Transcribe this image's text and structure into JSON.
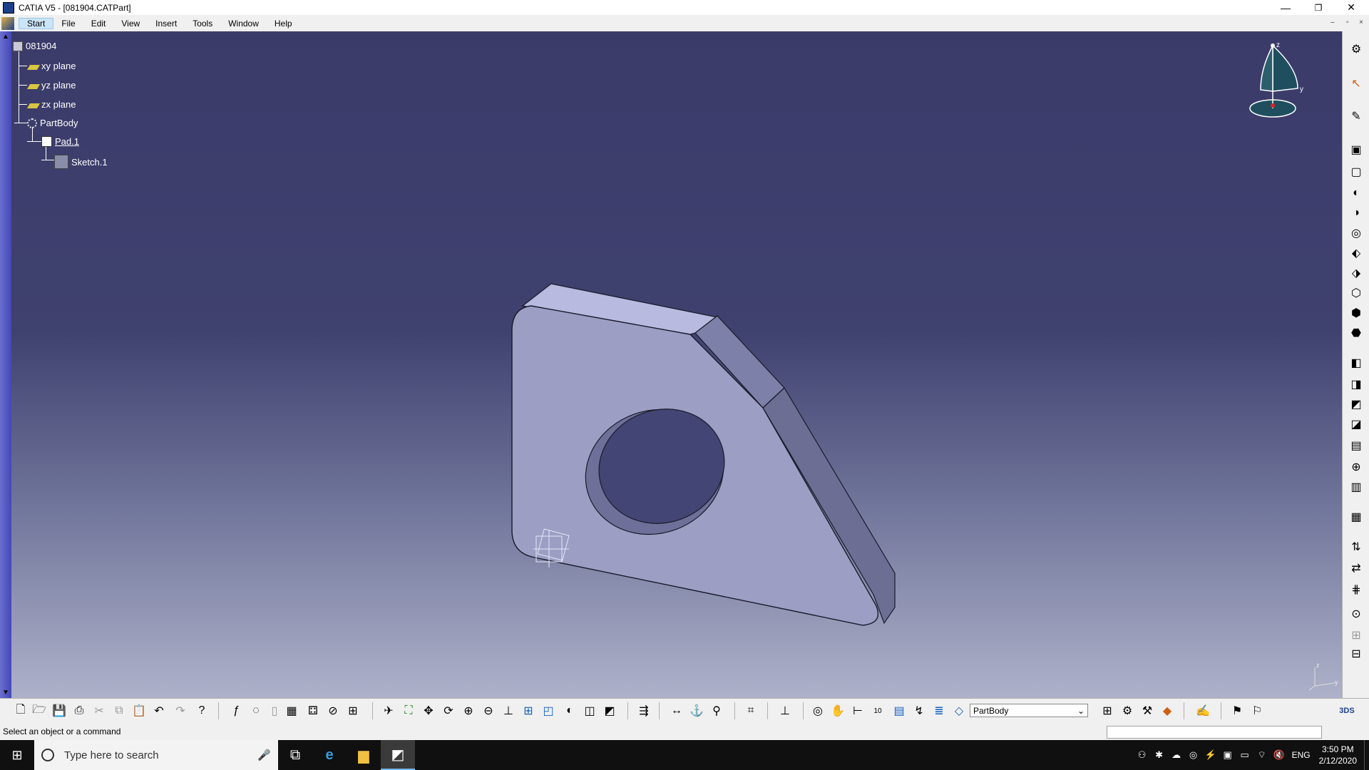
{
  "window": {
    "title": "CATIA V5 - [081904.CATPart]",
    "controls": {
      "minimize": "—",
      "restore": "❐",
      "close": "✕"
    }
  },
  "menubar": {
    "items": [
      "Start",
      "File",
      "Edit",
      "View",
      "Insert",
      "Tools",
      "Window",
      "Help"
    ],
    "active_index": 0
  },
  "mdi_controls": {
    "minimize": "–",
    "restore": "▫",
    "close": "×"
  },
  "spec_tree": {
    "root": "081904",
    "nodes": [
      {
        "label": "xy plane",
        "icon": "plane-icon"
      },
      {
        "label": "yz plane",
        "icon": "plane-icon"
      },
      {
        "label": "zx plane",
        "icon": "plane-icon"
      },
      {
        "label": "PartBody",
        "icon": "body-icon"
      },
      {
        "label": "Pad.1",
        "icon": "pad-icon"
      },
      {
        "label": "Sketch.1",
        "icon": "sketch-icon"
      }
    ]
  },
  "compass": {
    "x": "x",
    "y": "y",
    "z": "z"
  },
  "axis_triad": {
    "z": "z",
    "y": "y",
    "x": "x"
  },
  "toolbar_bottom": {
    "active_body": "PartBody"
  },
  "status": {
    "message": "Select an object or a command"
  },
  "taskbar": {
    "search_placeholder": "Type here to search",
    "language": "ENG",
    "time": "3:50 PM",
    "date": "2/12/2020"
  },
  "colors": {
    "viewport_top": "#3b3b6a",
    "viewport_bottom": "#aeb1c9",
    "part_face": "#9c9ec4",
    "part_edge_dark": "#6c6e94",
    "tree_text": "#ffffff"
  }
}
